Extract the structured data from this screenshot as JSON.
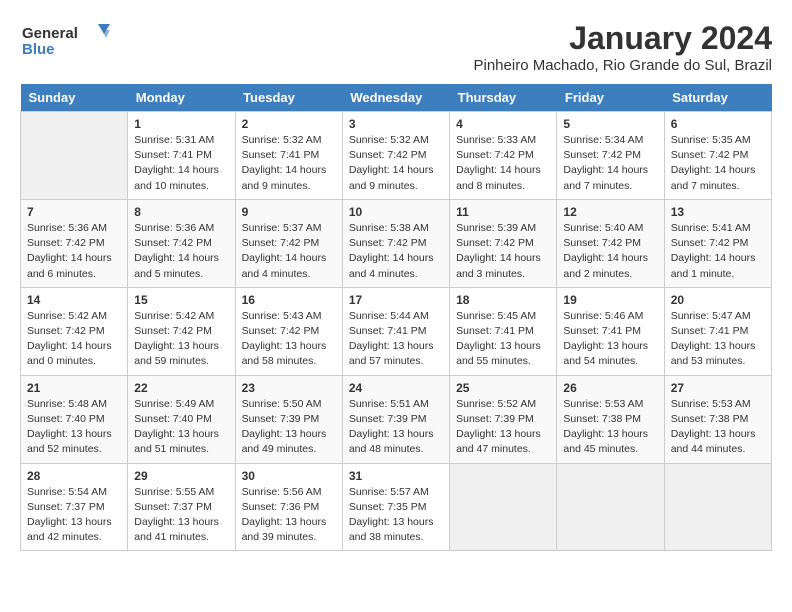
{
  "header": {
    "logo_line1": "General",
    "logo_line2": "Blue",
    "title": "January 2024",
    "subtitle": "Pinheiro Machado, Rio Grande do Sul, Brazil"
  },
  "days_of_week": [
    "Sunday",
    "Monday",
    "Tuesday",
    "Wednesday",
    "Thursday",
    "Friday",
    "Saturday"
  ],
  "weeks": [
    [
      {
        "day": "",
        "sunrise": "",
        "sunset": "",
        "daylight": ""
      },
      {
        "day": "1",
        "sunrise": "Sunrise: 5:31 AM",
        "sunset": "Sunset: 7:41 PM",
        "daylight": "Daylight: 14 hours and 10 minutes."
      },
      {
        "day": "2",
        "sunrise": "Sunrise: 5:32 AM",
        "sunset": "Sunset: 7:41 PM",
        "daylight": "Daylight: 14 hours and 9 minutes."
      },
      {
        "day": "3",
        "sunrise": "Sunrise: 5:32 AM",
        "sunset": "Sunset: 7:42 PM",
        "daylight": "Daylight: 14 hours and 9 minutes."
      },
      {
        "day": "4",
        "sunrise": "Sunrise: 5:33 AM",
        "sunset": "Sunset: 7:42 PM",
        "daylight": "Daylight: 14 hours and 8 minutes."
      },
      {
        "day": "5",
        "sunrise": "Sunrise: 5:34 AM",
        "sunset": "Sunset: 7:42 PM",
        "daylight": "Daylight: 14 hours and 7 minutes."
      },
      {
        "day": "6",
        "sunrise": "Sunrise: 5:35 AM",
        "sunset": "Sunset: 7:42 PM",
        "daylight": "Daylight: 14 hours and 7 minutes."
      }
    ],
    [
      {
        "day": "7",
        "sunrise": "Sunrise: 5:36 AM",
        "sunset": "Sunset: 7:42 PM",
        "daylight": "Daylight: 14 hours and 6 minutes."
      },
      {
        "day": "8",
        "sunrise": "Sunrise: 5:36 AM",
        "sunset": "Sunset: 7:42 PM",
        "daylight": "Daylight: 14 hours and 5 minutes."
      },
      {
        "day": "9",
        "sunrise": "Sunrise: 5:37 AM",
        "sunset": "Sunset: 7:42 PM",
        "daylight": "Daylight: 14 hours and 4 minutes."
      },
      {
        "day": "10",
        "sunrise": "Sunrise: 5:38 AM",
        "sunset": "Sunset: 7:42 PM",
        "daylight": "Daylight: 14 hours and 4 minutes."
      },
      {
        "day": "11",
        "sunrise": "Sunrise: 5:39 AM",
        "sunset": "Sunset: 7:42 PM",
        "daylight": "Daylight: 14 hours and 3 minutes."
      },
      {
        "day": "12",
        "sunrise": "Sunrise: 5:40 AM",
        "sunset": "Sunset: 7:42 PM",
        "daylight": "Daylight: 14 hours and 2 minutes."
      },
      {
        "day": "13",
        "sunrise": "Sunrise: 5:41 AM",
        "sunset": "Sunset: 7:42 PM",
        "daylight": "Daylight: 14 hours and 1 minute."
      }
    ],
    [
      {
        "day": "14",
        "sunrise": "Sunrise: 5:42 AM",
        "sunset": "Sunset: 7:42 PM",
        "daylight": "Daylight: 14 hours and 0 minutes."
      },
      {
        "day": "15",
        "sunrise": "Sunrise: 5:42 AM",
        "sunset": "Sunset: 7:42 PM",
        "daylight": "Daylight: 13 hours and 59 minutes."
      },
      {
        "day": "16",
        "sunrise": "Sunrise: 5:43 AM",
        "sunset": "Sunset: 7:42 PM",
        "daylight": "Daylight: 13 hours and 58 minutes."
      },
      {
        "day": "17",
        "sunrise": "Sunrise: 5:44 AM",
        "sunset": "Sunset: 7:41 PM",
        "daylight": "Daylight: 13 hours and 57 minutes."
      },
      {
        "day": "18",
        "sunrise": "Sunrise: 5:45 AM",
        "sunset": "Sunset: 7:41 PM",
        "daylight": "Daylight: 13 hours and 55 minutes."
      },
      {
        "day": "19",
        "sunrise": "Sunrise: 5:46 AM",
        "sunset": "Sunset: 7:41 PM",
        "daylight": "Daylight: 13 hours and 54 minutes."
      },
      {
        "day": "20",
        "sunrise": "Sunrise: 5:47 AM",
        "sunset": "Sunset: 7:41 PM",
        "daylight": "Daylight: 13 hours and 53 minutes."
      }
    ],
    [
      {
        "day": "21",
        "sunrise": "Sunrise: 5:48 AM",
        "sunset": "Sunset: 7:40 PM",
        "daylight": "Daylight: 13 hours and 52 minutes."
      },
      {
        "day": "22",
        "sunrise": "Sunrise: 5:49 AM",
        "sunset": "Sunset: 7:40 PM",
        "daylight": "Daylight: 13 hours and 51 minutes."
      },
      {
        "day": "23",
        "sunrise": "Sunrise: 5:50 AM",
        "sunset": "Sunset: 7:39 PM",
        "daylight": "Daylight: 13 hours and 49 minutes."
      },
      {
        "day": "24",
        "sunrise": "Sunrise: 5:51 AM",
        "sunset": "Sunset: 7:39 PM",
        "daylight": "Daylight: 13 hours and 48 minutes."
      },
      {
        "day": "25",
        "sunrise": "Sunrise: 5:52 AM",
        "sunset": "Sunset: 7:39 PM",
        "daylight": "Daylight: 13 hours and 47 minutes."
      },
      {
        "day": "26",
        "sunrise": "Sunrise: 5:53 AM",
        "sunset": "Sunset: 7:38 PM",
        "daylight": "Daylight: 13 hours and 45 minutes."
      },
      {
        "day": "27",
        "sunrise": "Sunrise: 5:53 AM",
        "sunset": "Sunset: 7:38 PM",
        "daylight": "Daylight: 13 hours and 44 minutes."
      }
    ],
    [
      {
        "day": "28",
        "sunrise": "Sunrise: 5:54 AM",
        "sunset": "Sunset: 7:37 PM",
        "daylight": "Daylight: 13 hours and 42 minutes."
      },
      {
        "day": "29",
        "sunrise": "Sunrise: 5:55 AM",
        "sunset": "Sunset: 7:37 PM",
        "daylight": "Daylight: 13 hours and 41 minutes."
      },
      {
        "day": "30",
        "sunrise": "Sunrise: 5:56 AM",
        "sunset": "Sunset: 7:36 PM",
        "daylight": "Daylight: 13 hours and 39 minutes."
      },
      {
        "day": "31",
        "sunrise": "Sunrise: 5:57 AM",
        "sunset": "Sunset: 7:35 PM",
        "daylight": "Daylight: 13 hours and 38 minutes."
      },
      {
        "day": "",
        "sunrise": "",
        "sunset": "",
        "daylight": ""
      },
      {
        "day": "",
        "sunrise": "",
        "sunset": "",
        "daylight": ""
      },
      {
        "day": "",
        "sunrise": "",
        "sunset": "",
        "daylight": ""
      }
    ]
  ]
}
